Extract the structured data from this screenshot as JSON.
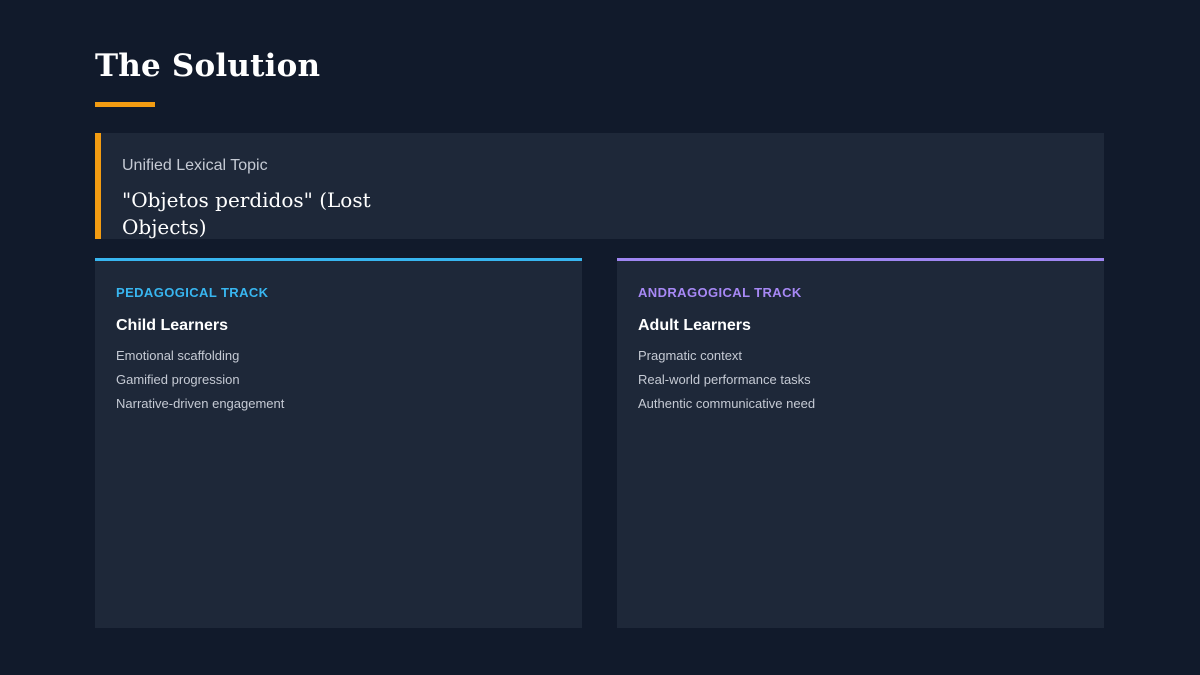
{
  "slide": {
    "title": "The Solution"
  },
  "topic": {
    "label": "Unified Lexical Topic",
    "value": "\"Objetos perdidos\" (Lost Objects)"
  },
  "tracks": [
    {
      "eyebrow": "PEDAGOGICAL TRACK",
      "heading": "Child Learners",
      "accent_color": "#38b6f0",
      "items": [
        "Emotional scaffolding",
        "Gamified progression",
        "Narrative-driven engagement"
      ]
    },
    {
      "eyebrow": "ANDRAGOGICAL TRACK",
      "heading": "Adult Learners",
      "accent_color": "#a788f5",
      "items": [
        "Pragmatic context",
        "Real-world performance tasks",
        "Authentic communicative need"
      ]
    }
  ],
  "colors": {
    "background": "#111a2b",
    "card": "#1e2839",
    "title_accent": "#f39c12"
  }
}
